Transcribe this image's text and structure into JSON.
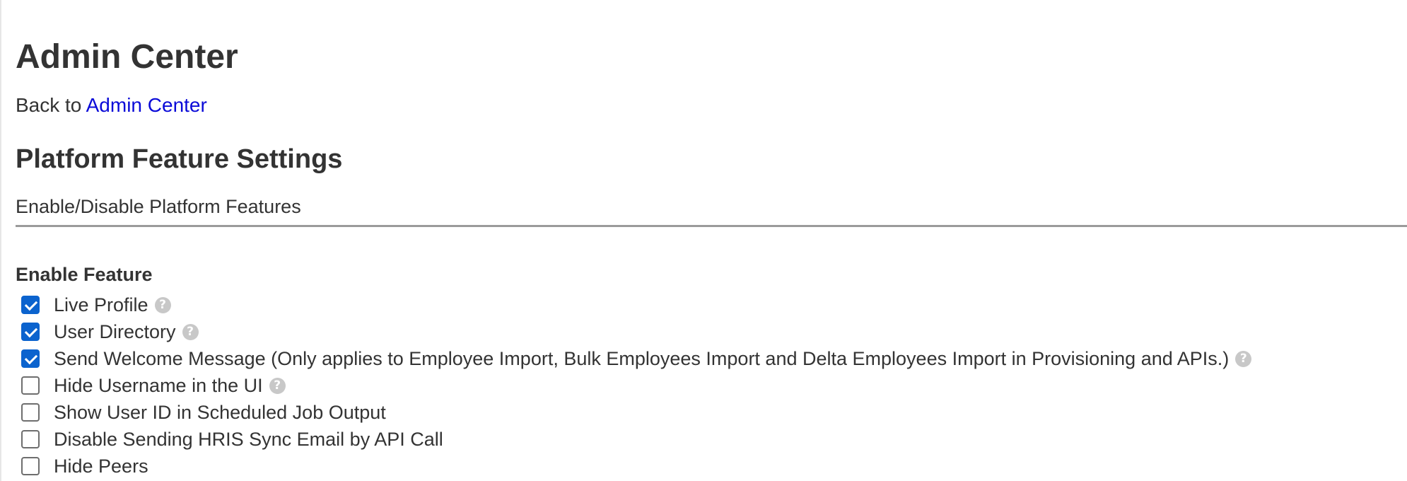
{
  "header": {
    "title": "Admin Center",
    "back_prefix": "Back to",
    "back_link": "Admin Center"
  },
  "section": {
    "title": "Platform Feature Settings",
    "subtitle": "Enable/Disable Platform Features"
  },
  "features": {
    "group_label": "Enable Feature",
    "items": [
      {
        "label": "Live Profile",
        "checked": true,
        "help": true
      },
      {
        "label": "User Directory",
        "checked": true,
        "help": true
      },
      {
        "label": "Send Welcome Message (Only applies to Employee Import, Bulk Employees Import and Delta Employees Import in Provisioning and APIs.)",
        "checked": true,
        "help": true
      },
      {
        "label": "Hide Username in the UI",
        "checked": false,
        "help": true
      },
      {
        "label": "Show User ID in Scheduled Job Output",
        "checked": false,
        "help": false
      },
      {
        "label": "Disable Sending HRIS Sync Email by API Call",
        "checked": false,
        "help": false
      },
      {
        "label": "Hide Peers",
        "checked": false,
        "help": false
      }
    ]
  },
  "icons": {
    "help": "question-circle-icon",
    "checkbox_checked": "checkbox-checked-icon"
  },
  "colors": {
    "link": "#0a0ad8",
    "checkbox_accent": "#0b63ce",
    "text": "#333333",
    "divider": "#9a9a9a",
    "help_icon": "#c8c8c8"
  }
}
